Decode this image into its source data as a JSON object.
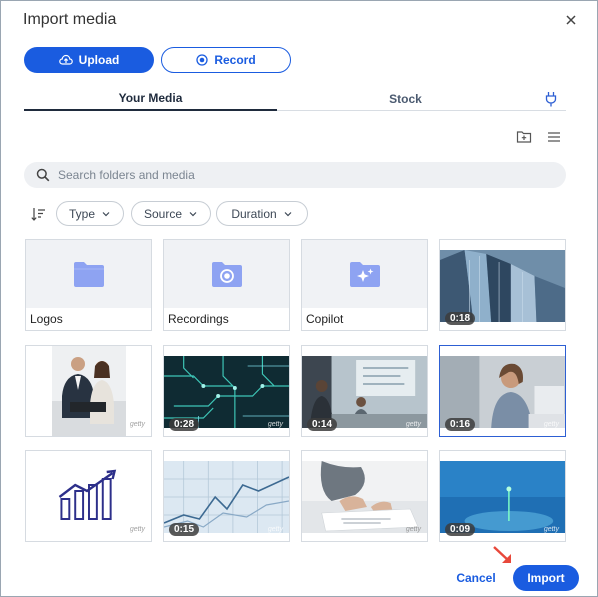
{
  "dialog": {
    "title": "Import media"
  },
  "actions": {
    "upload_label": "Upload",
    "record_label": "Record"
  },
  "tabs": [
    {
      "label": "Your Media",
      "active": true
    },
    {
      "label": "Stock",
      "active": false
    }
  ],
  "search": {
    "placeholder": "Search folders and media",
    "value": ""
  },
  "filters": {
    "type_label": "Type",
    "source_label": "Source",
    "duration_label": "Duration"
  },
  "folders": [
    {
      "label": "Logos"
    },
    {
      "label": "Recordings"
    },
    {
      "label": "Copilot"
    }
  ],
  "media": [
    {
      "subject": "skyscrapers",
      "duration": "0:18",
      "watermark": "getty"
    },
    {
      "subject": "business-people",
      "duration": "",
      "watermark": "getty"
    },
    {
      "subject": "circuit-board",
      "duration": "0:28",
      "watermark": "getty"
    },
    {
      "subject": "office-meeting",
      "duration": "0:14",
      "watermark": "getty"
    },
    {
      "subject": "woman-laptop",
      "duration": "0:16",
      "watermark": "getty",
      "selected": true
    },
    {
      "subject": "growth-chart-icon",
      "duration": "",
      "watermark": "getty"
    },
    {
      "subject": "line-graph",
      "duration": "0:15",
      "watermark": "getty"
    },
    {
      "subject": "hands-paperwork",
      "duration": "",
      "watermark": "getty"
    },
    {
      "subject": "blue-light",
      "duration": "0:09",
      "watermark": "getty"
    }
  ],
  "footer": {
    "cancel_label": "Cancel",
    "import_label": "Import"
  },
  "colors": {
    "primary": "#1a5ce0",
    "folder_icon": "#8ea3f2",
    "annotation_arrow": "#e8483b"
  }
}
